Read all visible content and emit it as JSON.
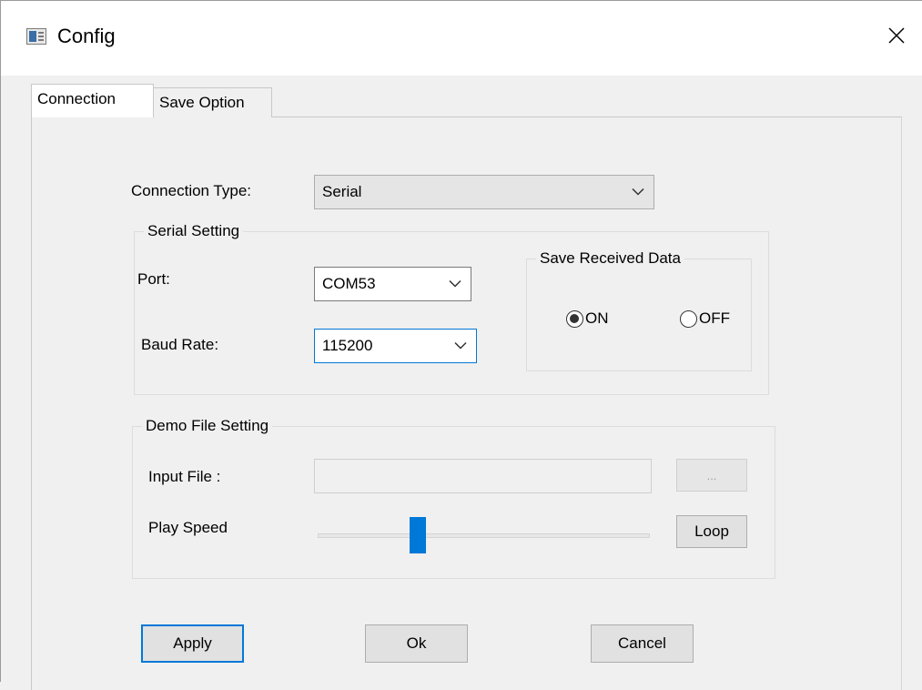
{
  "window": {
    "title": "Config",
    "icon": "window-app-icon",
    "close_icon": "close-icon"
  },
  "tabs": [
    {
      "label": "Connection",
      "active": true
    },
    {
      "label": "Save Option",
      "active": false
    }
  ],
  "connection": {
    "type_label": "Connection Type:",
    "type_value": "Serial"
  },
  "serial": {
    "group_title": "Serial Setting",
    "port_label": "Port:",
    "port_value": "COM53",
    "baud_label": "Baud Rate:",
    "baud_value": "115200"
  },
  "save_received": {
    "group_title": "Save Received Data",
    "on_label": "ON",
    "off_label": "OFF",
    "selected": "ON"
  },
  "demo": {
    "group_title": "Demo File Setting",
    "input_label": "Input File :",
    "input_value": "",
    "browse_label": "...",
    "speed_label": "Play Speed",
    "speed_level": 0.29,
    "loop_label": "Loop"
  },
  "buttons": {
    "apply": "Apply",
    "ok": "Ok",
    "cancel": "Cancel"
  },
  "colors": {
    "accent": "#0078d7",
    "window_bg": "#f0f0f0"
  }
}
